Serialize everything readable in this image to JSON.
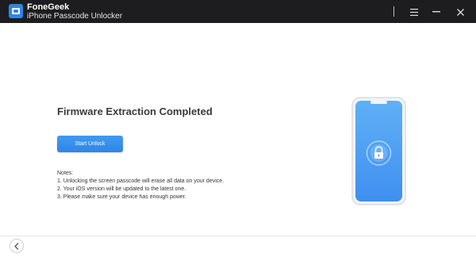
{
  "window": {
    "app_name": "FoneGeek",
    "app_subtitle": "iPhone Passcode Unlocker",
    "icons": {
      "logo": "fonegeek-logo-icon",
      "menu": "hamburger-menu-icon",
      "minimize": "minimize-icon",
      "close": "close-icon"
    }
  },
  "main": {
    "title": "Firmware Extraction Completed",
    "start_button_label": "Start Unlock",
    "notes": {
      "heading": "Notes:",
      "items": [
        "1. Unlocking the screen passcode will erase all data on your device.",
        "2. Your iOS version will be updated to the latest one.",
        "3. Please make sure your device has enough power."
      ]
    },
    "illustration": {
      "icon": "phone-lock-illustration",
      "accent": "#2f86e6"
    }
  },
  "footer": {
    "back_icon": "chevron-left-icon"
  },
  "colors": {
    "titlebar": "#1d1d1f",
    "primary": "#2f86e6",
    "text": "#3a3a3a"
  }
}
